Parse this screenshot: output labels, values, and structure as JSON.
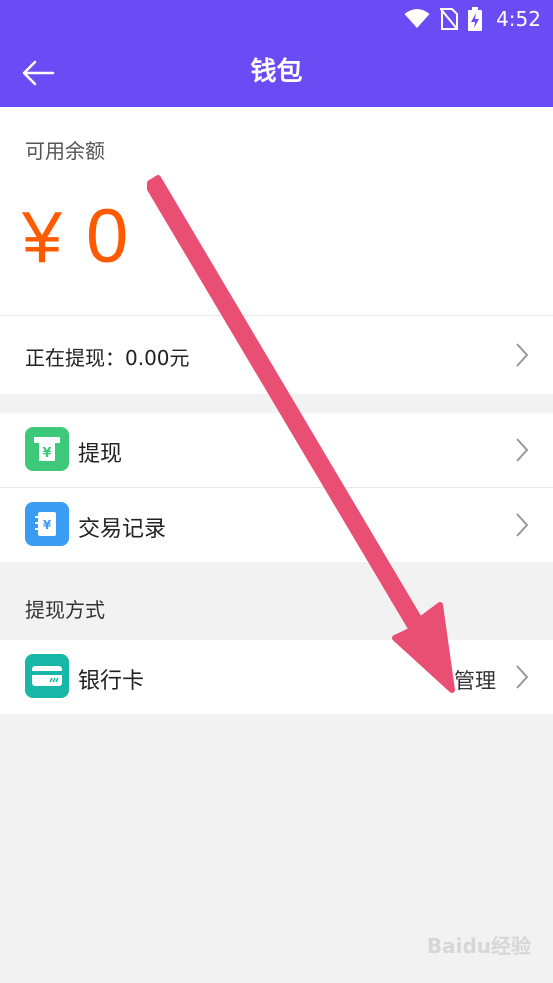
{
  "status_bar": {
    "time": "4:52"
  },
  "header": {
    "title": "钱包"
  },
  "balance": {
    "label": "可用余额",
    "currency": "¥",
    "amount": "0"
  },
  "withdrawing": {
    "text": "正在提现：0.00元"
  },
  "menu": {
    "withdraw": "提现",
    "transactions": "交易记录"
  },
  "methods": {
    "section_title": "提现方式",
    "bank_card": "银行卡",
    "manage": "管理"
  },
  "watermark": "Baidu经验",
  "colors": {
    "header_bg": "#6a4cf5",
    "amount": "#ff5a00",
    "withdraw_icon": "#3ec97a",
    "transactions_icon": "#3a9cf3",
    "bank_icon": "#17b6a6",
    "annotation_arrow": "#e84f73"
  },
  "icons": {
    "back": "arrow-left-icon",
    "wifi": "wifi-icon",
    "sim": "no-sim-icon",
    "battery": "battery-charging-icon",
    "chevron": "chevron-right-icon"
  }
}
